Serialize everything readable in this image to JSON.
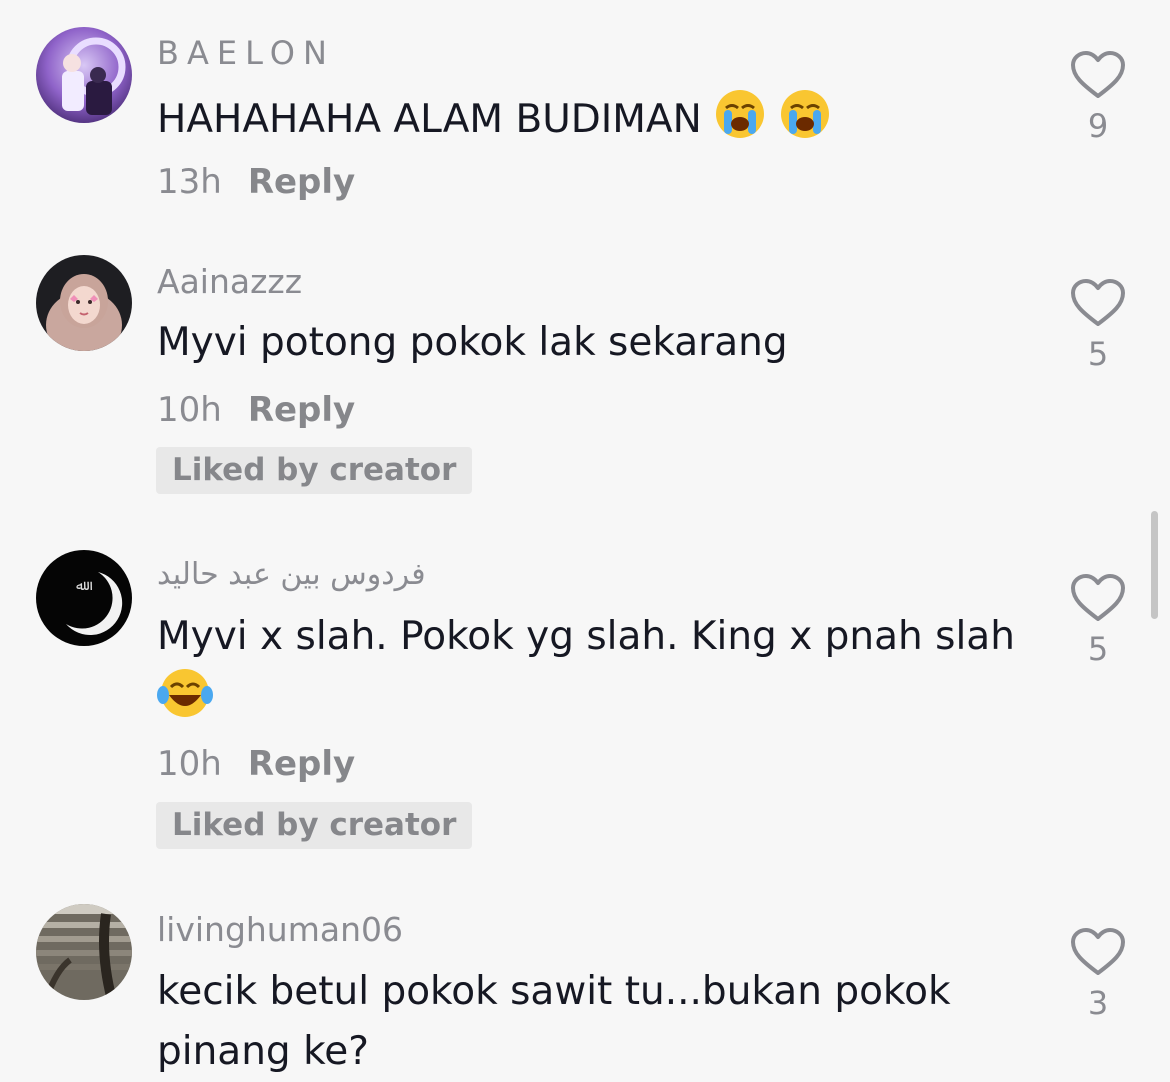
{
  "comments": [
    {
      "username": "BAELON",
      "text": "HAHAHAHA ALAM BUDIMAN",
      "emoji": [
        "loudly-crying-face",
        "loudly-crying-face"
      ],
      "time": "13h",
      "reply_label": "Reply",
      "likes": "9"
    },
    {
      "username": "Aainazzz",
      "text": "Myvi potong pokok lak sekarang",
      "time": "10h",
      "reply_label": "Reply",
      "liked_by_creator": "Liked by creator",
      "likes": "5"
    },
    {
      "username": "فردوس  بين عبد حاليد",
      "text": "Myvi x slah. Pokok yg slah. King x pnah slah",
      "emoji": [
        "face-with-tears-of-joy"
      ],
      "time": "10h",
      "reply_label": "Reply",
      "liked_by_creator": "Liked by creator",
      "likes": "5"
    },
    {
      "username": "livinghuman06",
      "text": "kecik betul pokok sawit tu...bukan pokok pinang ke?",
      "likes": "3"
    }
  ],
  "colors": {
    "background": "#f7f7f7",
    "primary_text": "#161823",
    "secondary_text": "#8a8b91",
    "badge_bg": "#e8e8e8"
  },
  "icons": {
    "like": "heart-outline-icon"
  }
}
